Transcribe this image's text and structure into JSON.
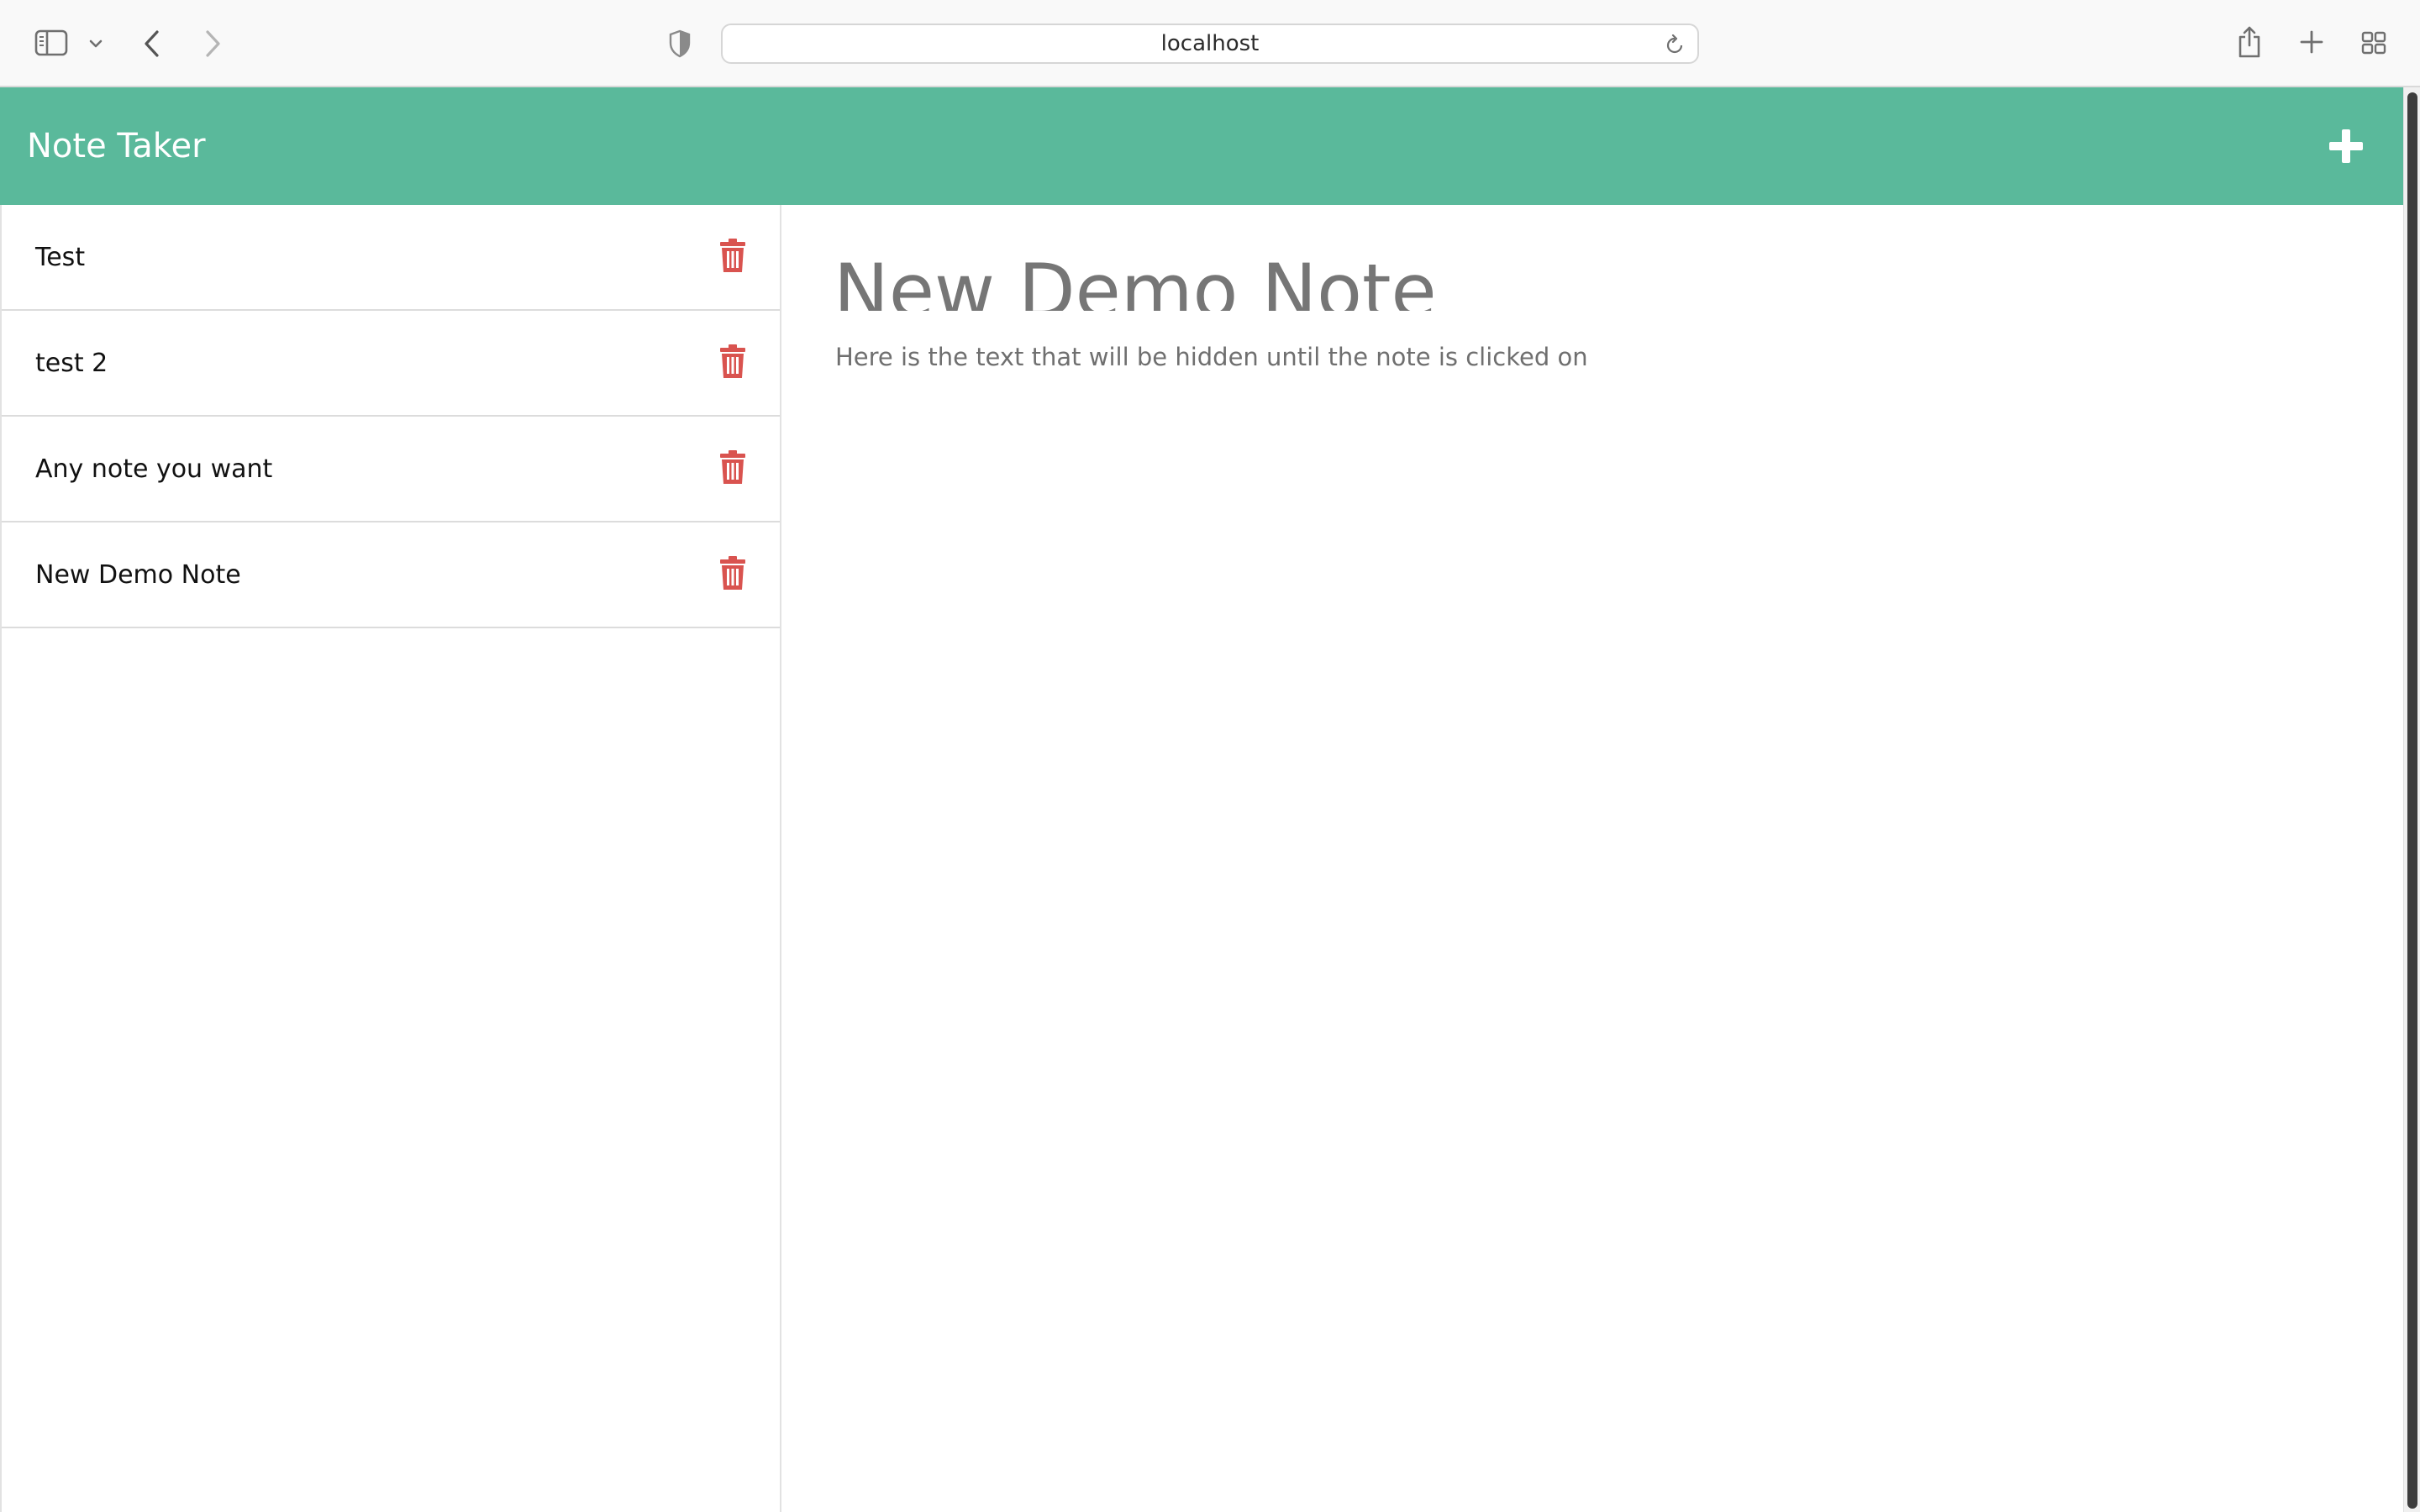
{
  "browser": {
    "url": "localhost",
    "icons": {
      "sidebar": "sidebar-icon",
      "sidebar_menu": "chevron-down-icon",
      "back": "chevron-left-icon",
      "forward": "chevron-right-icon",
      "privacy": "shield-icon",
      "reload": "reload-icon",
      "share": "share-icon",
      "new_tab": "plus-icon",
      "tab_overview": "grid-icon"
    }
  },
  "app": {
    "title": "Note Taker",
    "accent_color": "#5ab99b",
    "delete_color": "#d9534f",
    "new_note_icon": "plus-icon"
  },
  "notes": [
    {
      "title": "Test"
    },
    {
      "title": "test 2"
    },
    {
      "title": "Any note you want"
    },
    {
      "title": "New Demo Note"
    }
  ],
  "active_note": {
    "title": "New Demo Note",
    "text": "Here is the text that will be hidden until the note is clicked on"
  }
}
